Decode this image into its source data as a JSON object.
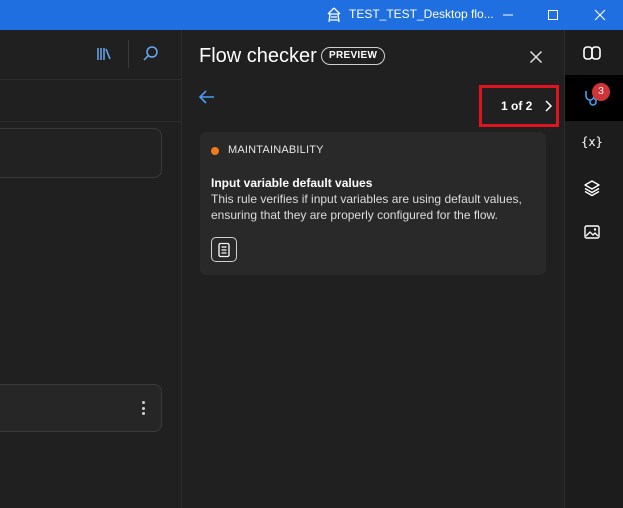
{
  "window": {
    "title": "TEST_TEST_Desktop flo...",
    "minimize_icon": "minimize-icon",
    "maximize_icon": "maximize-icon",
    "close_icon": "close-icon"
  },
  "panel": {
    "title": "Flow checker",
    "badge": "PREVIEW",
    "pager": "1 of 2",
    "items": [
      {
        "category": "MAINTAINABILITY",
        "category_color": "#f27a1a",
        "title": "Input variable default values",
        "description": "This rule verifies if input variables are using default values, ensuring that they are properly configured for the flow."
      }
    ]
  },
  "rail": {
    "errors_count": "3",
    "variables_label": "{x}"
  },
  "colors": {
    "accent": "#1f6fe0",
    "highlight": "#e0141e",
    "error_badge": "#d13438"
  }
}
